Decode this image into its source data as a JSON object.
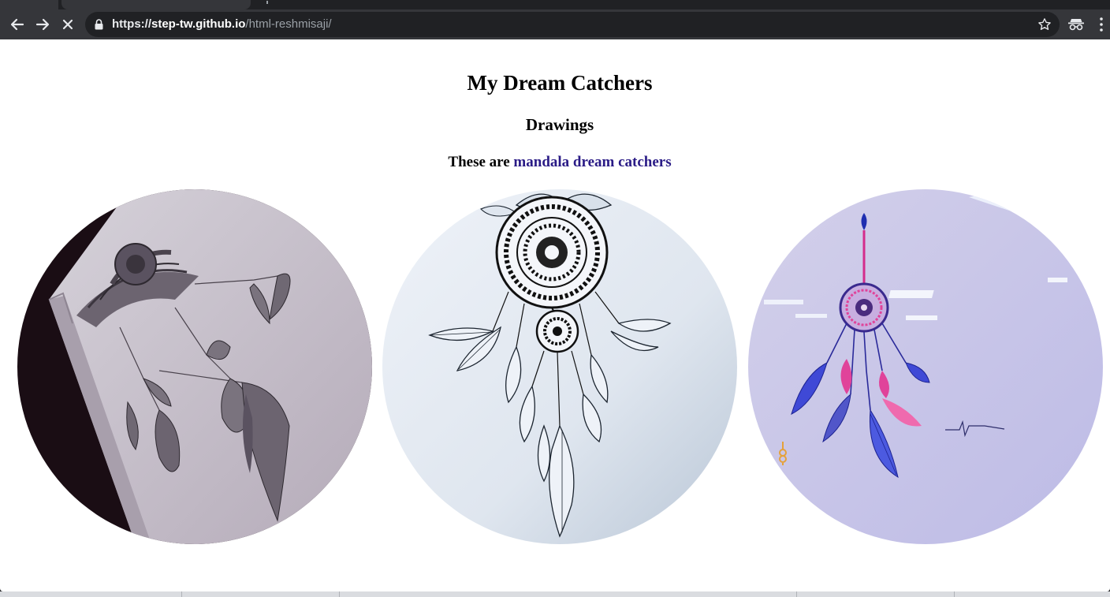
{
  "browser": {
    "url_scheme": "https://",
    "url_host": "step-tw.github.io",
    "url_path": "/html-reshmisaji/",
    "icons": [
      "back-arrow-icon",
      "forward-arrow-icon",
      "stop-loading-icon",
      "lock-icon",
      "bookmark-star-icon",
      "incognito-icon",
      "kebab-menu-icon"
    ]
  },
  "page": {
    "title": "My Dream Catchers",
    "subtitle": "Drawings",
    "caption_prefix": "These are ",
    "caption_link": "mandala dream catchers",
    "link_color": "#2a1b86"
  },
  "gallery": {
    "images": [
      {
        "name": "pencil-mandala-dreamcatcher-drawing"
      },
      {
        "name": "ink-dreamcatcher-drawing"
      },
      {
        "name": "colored-dreamcatcher-drawing"
      }
    ]
  },
  "colors": {
    "chrome_dark": "#202124",
    "toolbar": "#35363a",
    "page_bg": "#ffffff"
  }
}
